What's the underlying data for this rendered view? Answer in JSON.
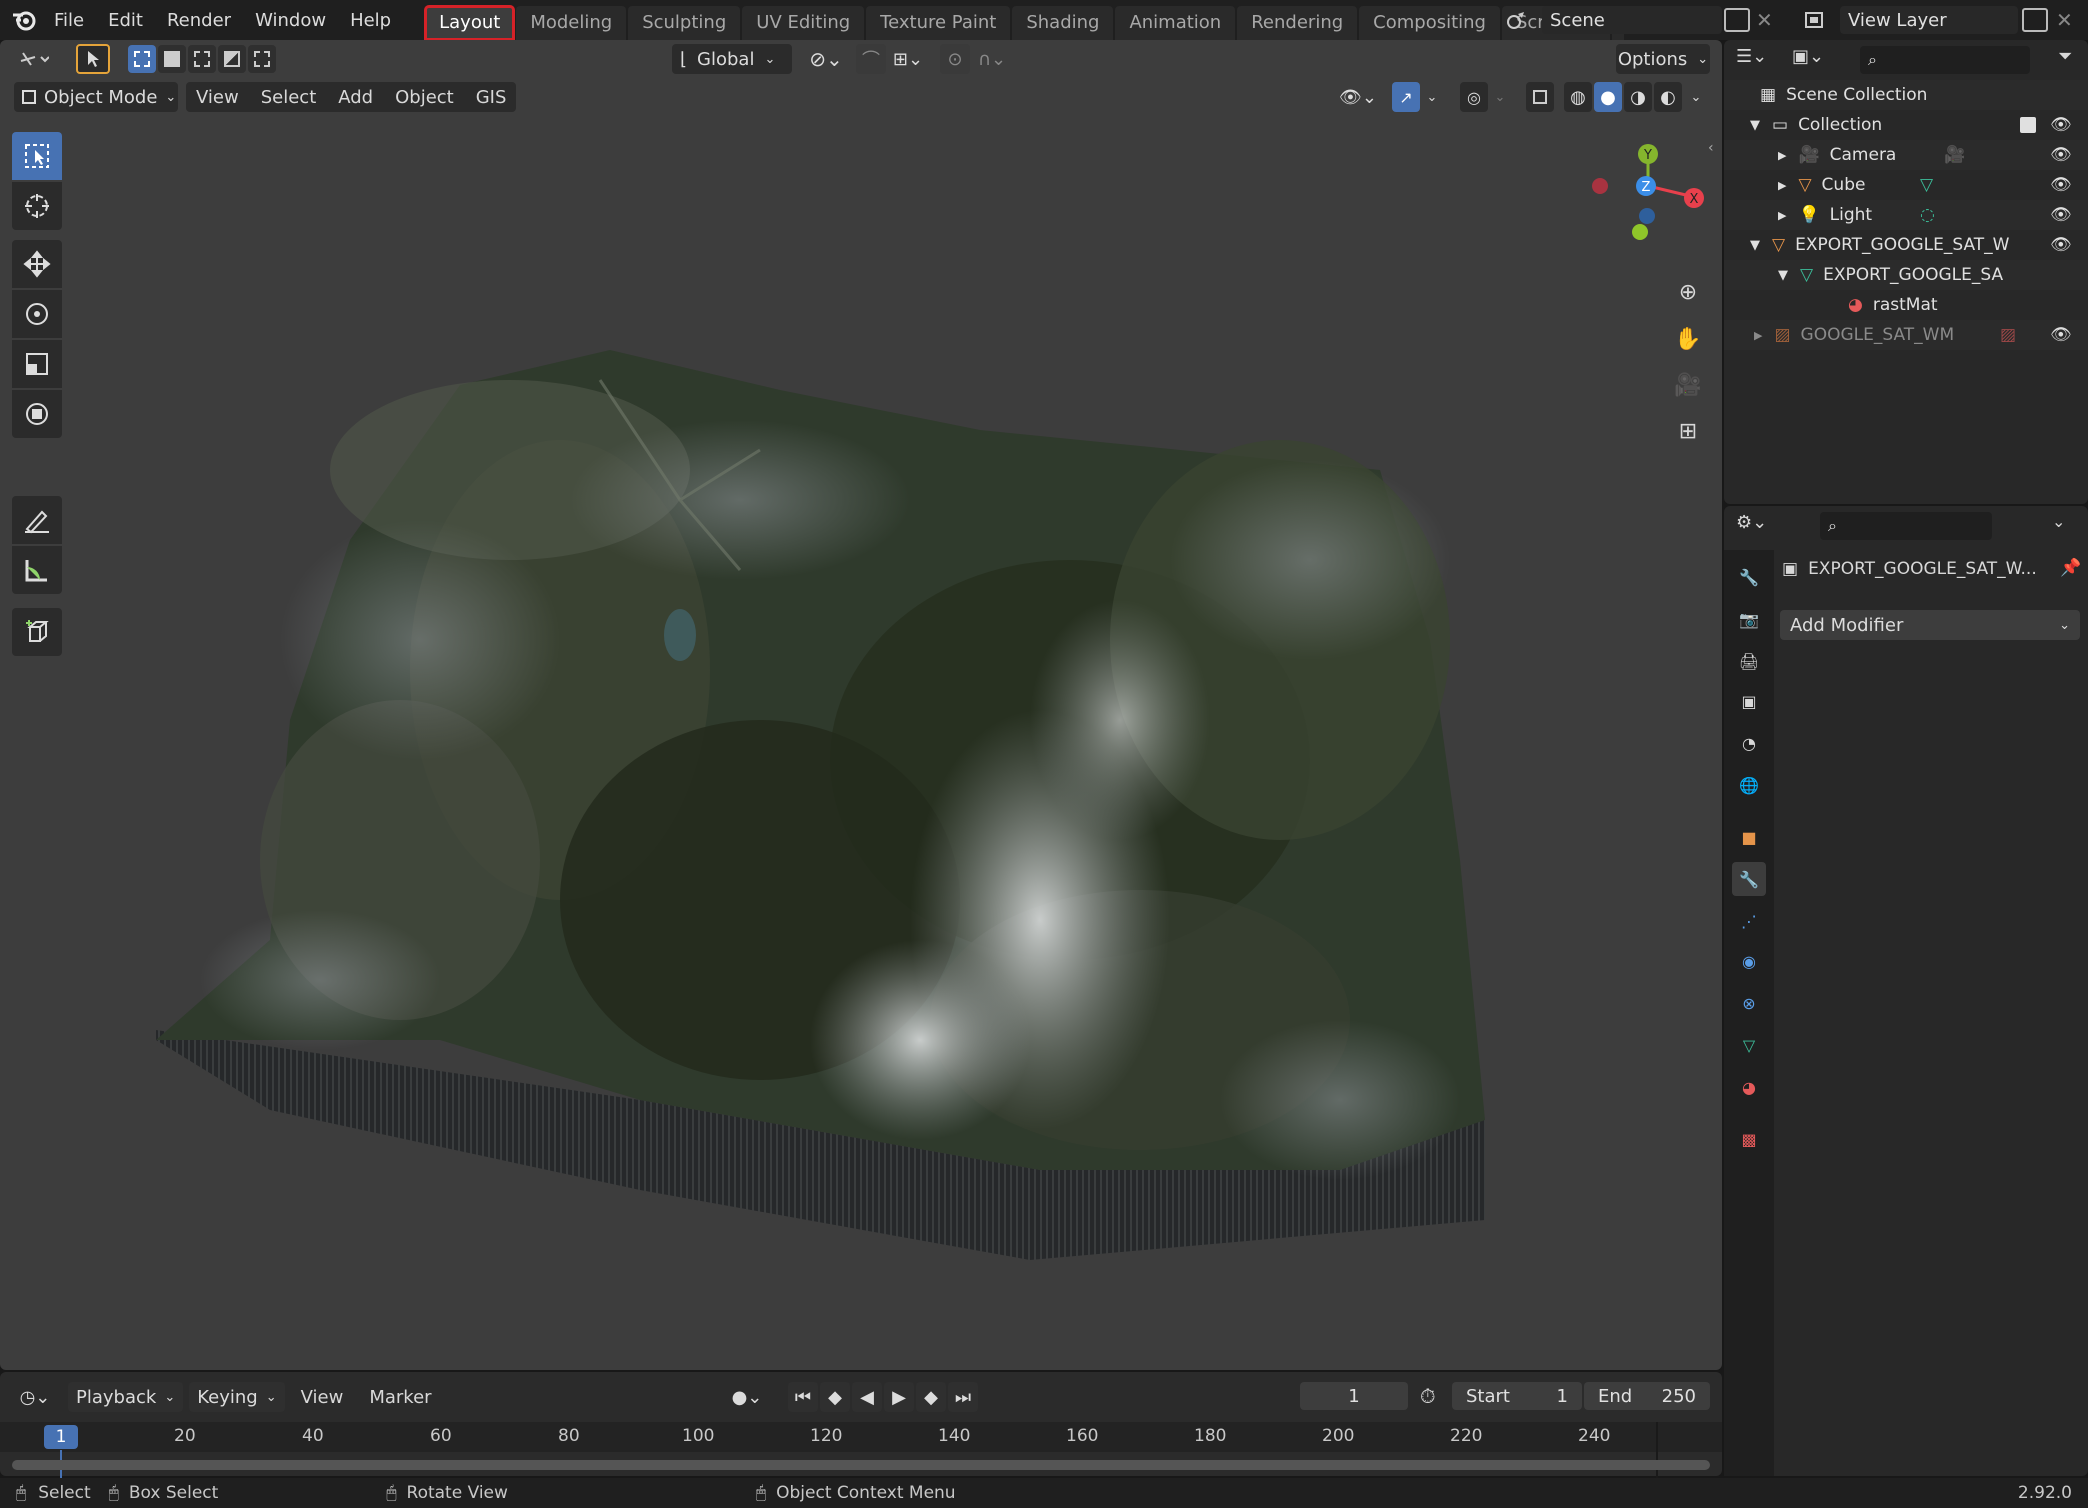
{
  "menu": [
    "File",
    "Edit",
    "Render",
    "Window",
    "Help"
  ],
  "workspaces": [
    "Layout",
    "Modeling",
    "Sculpting",
    "UV Editing",
    "Texture Paint",
    "Shading",
    "Animation",
    "Rendering",
    "Compositing",
    "Scripting",
    "+"
  ],
  "scene": {
    "name": "Scene",
    "view_layer": "View Layer"
  },
  "viewport": {
    "orientation": "Global",
    "options_label": "Options",
    "mode": "Object Mode",
    "menus": [
      "View",
      "Select",
      "Add",
      "Object",
      "GIS"
    ],
    "gizmo": {
      "x": "X",
      "y": "Y",
      "z": "Z"
    }
  },
  "outliner": {
    "root": "Scene Collection",
    "collection": "Collection",
    "items": [
      "Camera",
      "Cube",
      "Light"
    ],
    "export_obj": "EXPORT_GOOGLE_SAT_W",
    "export_mesh": "EXPORT_GOOGLE_SA",
    "material": "rastMat",
    "image": "GOOGLE_SAT_WM"
  },
  "properties": {
    "object_name": "EXPORT_GOOGLE_SAT_W...",
    "add_modifier": "Add Modifier"
  },
  "timeline": {
    "menus": [
      "Playback",
      "Keying",
      "View",
      "Marker"
    ],
    "current_frame": "1",
    "start_label": "Start",
    "start": "1",
    "end_label": "End",
    "end": "250",
    "marker_frame": "1",
    "ticks": [
      "20",
      "40",
      "60",
      "80",
      "100",
      "120",
      "140",
      "160",
      "180",
      "200",
      "220",
      "240"
    ]
  },
  "status": {
    "select": "Select",
    "box_select": "Box Select",
    "rotate": "Rotate View",
    "context": "Object Context Menu",
    "version": "2.92.0"
  },
  "colors": {
    "accent": "#4772b3",
    "highlight": "#d62228",
    "x_axis": "#e8404c",
    "y_axis": "#85b52d",
    "z_axis": "#3b8ee8"
  }
}
